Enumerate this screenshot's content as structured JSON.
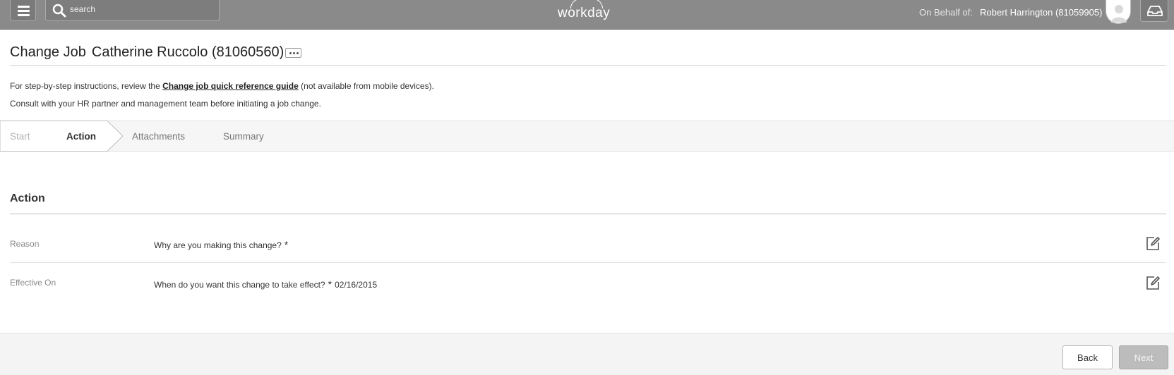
{
  "header": {
    "search_placeholder": "search",
    "logo_text": "workday",
    "on_behalf_label": "On Behalf of:",
    "on_behalf_name": "Robert Harrington (81059905)"
  },
  "page": {
    "title": "Change Job",
    "subject": "Catherine Ruccolo (81060560)",
    "info_prefix": "For step-by-step instructions, review the ",
    "info_link": "Change job quick reference guide",
    "info_suffix": " (not available from mobile devices).",
    "info_line2": "Consult with your HR partner and management team before initiating a job change."
  },
  "steps": [
    {
      "label": "Start",
      "state": "done"
    },
    {
      "label": "Action",
      "state": "active"
    },
    {
      "label": "Attachments",
      "state": "pending"
    },
    {
      "label": "Summary",
      "state": "pending"
    }
  ],
  "section": {
    "title": "Action",
    "fields": [
      {
        "label": "Reason",
        "prompt": "Why are you making this change?",
        "required": "*",
        "value": ""
      },
      {
        "label": "Effective On",
        "prompt": "When do you want this change to take effect?",
        "required": "*",
        "value": "02/16/2015"
      }
    ]
  },
  "footer": {
    "back_label": "Back",
    "next_label": "Next"
  },
  "colors": {
    "topbar": "#8a8a8a",
    "stepbar": "#f6f6f6",
    "next_disabled": "#bcbcbc"
  },
  "icons": [
    "menu-icon",
    "search-icon",
    "avatar-icon",
    "inbox-icon",
    "related-actions-icon",
    "edit-icon"
  ]
}
